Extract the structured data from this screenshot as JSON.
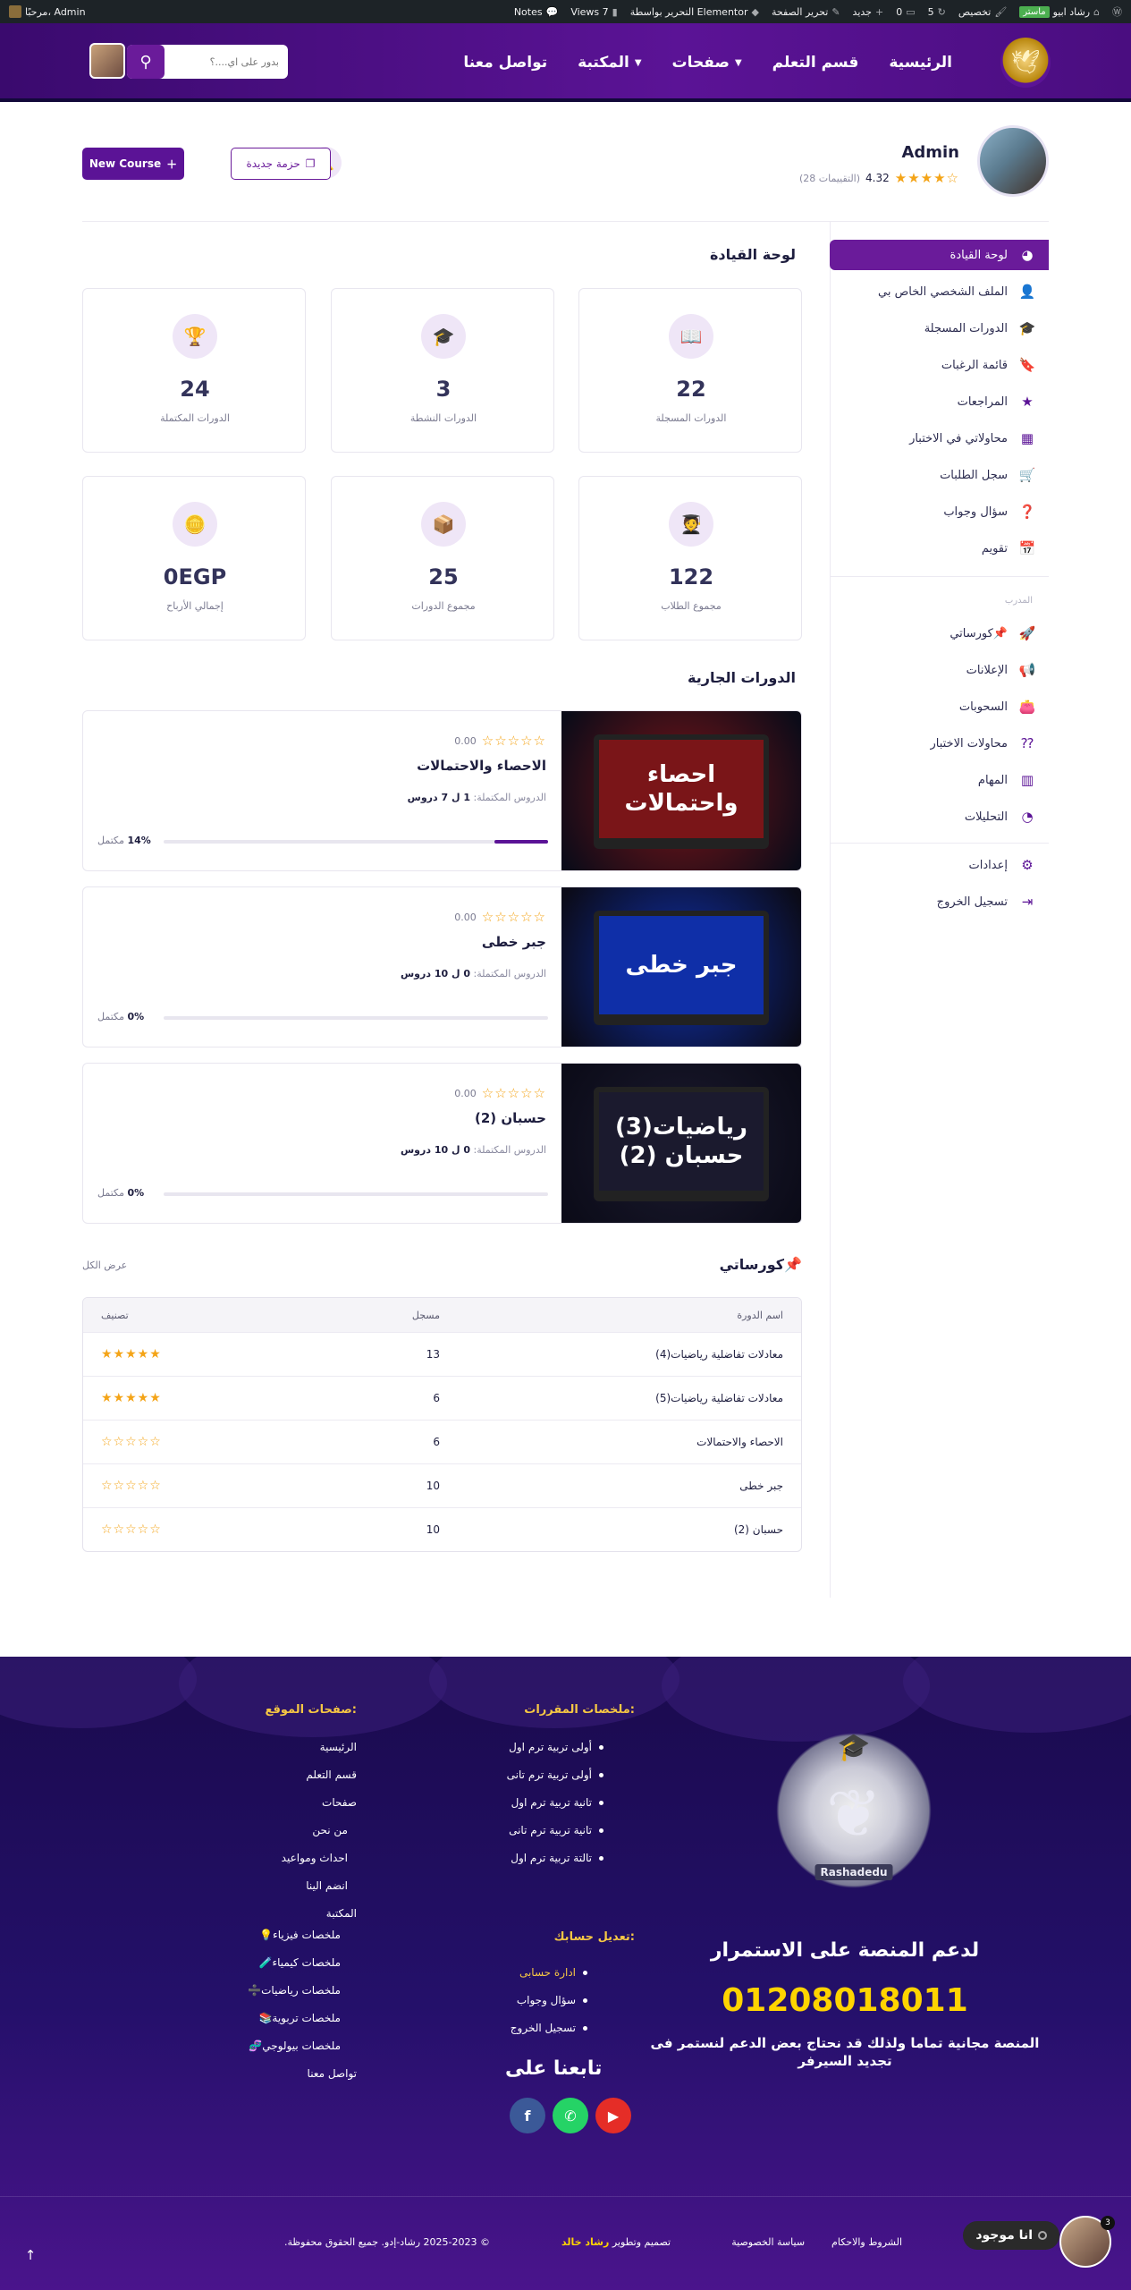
{
  "adminbar": {
    "items_right": [
      "رشاد ابيو",
      "ماستر",
      "تخصيص",
      "5",
      "0",
      "جديد",
      "تحرير الصفحة",
      "التحرير بواسطة Elementor",
      "Views 7",
      "Notes"
    ],
    "greeting": "مرحبًا، Admin"
  },
  "header": {
    "nav": [
      "الرئيسية",
      "قسم التعلم",
      "صفحات",
      "المكتبة",
      "تواصل معنا"
    ],
    "search_placeholder": "بدور على اي....؟"
  },
  "profile": {
    "name": "Admin",
    "rating": "4.32",
    "reviews": "(28 التقييمات)",
    "btn_package": "حزمة جديدة",
    "btn_new_course": "New Course"
  },
  "sidebar": {
    "main": [
      {
        "label": "لوحة القيادة",
        "icon": "palette-icon"
      },
      {
        "label": "الملف الشخصي الخاص بي",
        "icon": "user-icon"
      },
      {
        "label": "الدورات المسجلة",
        "icon": "graduation-cap-icon"
      },
      {
        "label": "قائمة الرغبات",
        "icon": "bookmark-icon"
      },
      {
        "label": "المراجعات",
        "icon": "star-icon"
      },
      {
        "label": "محاولاتي في الاختبار",
        "icon": "cubes-icon"
      },
      {
        "label": "سجل الطلبات",
        "icon": "cart-icon"
      },
      {
        "label": "سؤال وجواب",
        "icon": "question-user-icon"
      },
      {
        "label": "تقويم",
        "icon": "calendar-icon"
      }
    ],
    "instructor_label": "المدرب",
    "instructor": [
      {
        "label": "كورساتي📌",
        "icon": "rocket-icon"
      },
      {
        "label": "الإعلانات",
        "icon": "megaphone-icon"
      },
      {
        "label": "السحوبات",
        "icon": "wallet-icon"
      },
      {
        "label": "محاولات الاختبار",
        "icon": "quiz-icon"
      },
      {
        "label": "المهام",
        "icon": "building-icon"
      },
      {
        "label": "التحليلات",
        "icon": "pie-chart-icon"
      }
    ],
    "bottom": [
      {
        "label": "إعدادات",
        "icon": "gear-icon"
      },
      {
        "label": "تسجيل الخروج",
        "icon": "logout-icon"
      }
    ]
  },
  "dashboard": {
    "title": "لوحة القيادة",
    "stats": [
      {
        "value": "22",
        "label": "الدورات المسجلة",
        "icon": "book-open-icon"
      },
      {
        "value": "3",
        "label": "الدورات النشطة",
        "icon": "graduation-cap-icon"
      },
      {
        "value": "24",
        "label": "الدورات المكتملة",
        "icon": "trophy-icon"
      },
      {
        "value": "122",
        "label": "مجموع الطلاب",
        "icon": "student-icon"
      },
      {
        "value": "25",
        "label": "مجموع الدورات",
        "icon": "box-icon"
      },
      {
        "value": "0EGP",
        "label": "إجمالي الأرباح",
        "icon": "coins-icon"
      }
    ]
  },
  "current_courses": {
    "title": "الدورات الجارية",
    "lessons_prefix": "الدروس المكتملة:",
    "pct_suffix": "مكتمل",
    "items": [
      {
        "title": "الاحصاء والاحتمالات",
        "rating": "0.00",
        "lessons": "1 ل 7 دروس",
        "progress": 14,
        "pct": "14%",
        "thumb": "احصاء\nواحتمالات",
        "thumb_bg": "#7a1518"
      },
      {
        "title": "جبر خطى",
        "rating": "0.00",
        "lessons": "0 ل 10 دروس",
        "progress": 0,
        "pct": "0%",
        "thumb": "جبر خطى",
        "thumb_bg": "#0f2fa8"
      },
      {
        "title": "حسبان (2)",
        "rating": "0.00",
        "lessons": "0 ل 10 دروس",
        "progress": 0,
        "pct": "0%",
        "thumb": "رياضيات(3)\nحسبان (2)",
        "thumb_bg": "#1b1a2e"
      }
    ]
  },
  "my_courses": {
    "title": "كورساتي📌",
    "view_all": "عرض الكل",
    "headers": [
      "اسم الدورة",
      "مسجل",
      "تصنيف"
    ],
    "rows": [
      {
        "name": "معادلات تفاضلية رياضيات(4)",
        "enrolled": "13",
        "stars": 5
      },
      {
        "name": "معادلات تفاضلية رياضيات(5)",
        "enrolled": "6",
        "stars": 5
      },
      {
        "name": "الاحصاء والاحتمالات",
        "enrolled": "6",
        "stars": 0
      },
      {
        "name": "جبر خطى",
        "enrolled": "10",
        "stars": 0
      },
      {
        "name": "حسبان (2)",
        "enrolled": "10",
        "stars": 0
      }
    ]
  },
  "footer": {
    "brand": "Rashadedu",
    "support_title": "لدعم المنصة على الاستمرار",
    "phone": "01208018011",
    "support_note": "المنصة مجانية تماما ولذلك قد نحتاج بعض الدعم لنستمر فى تجديد السيرفر",
    "summaries_title": "ملخصات المقررات:",
    "summaries": [
      "أولى تربية ترم اول",
      "أولى تربية ترم تانى",
      "تانية تربية ترم اول",
      "تانية تربية ترم تانى",
      "تالتة تربية ترم اول"
    ],
    "account_title": "تعديل حسابك:",
    "account": [
      "ادارة حسابى",
      "سؤال وجواب",
      "تسجيل الخروج"
    ],
    "pages_title": "صفحات الموقع:",
    "pages": [
      "الرئيسية",
      "قسم التعلم",
      "صفحات",
      "من نحن",
      "احداث ومواعيد",
      "انضم الينا",
      "المكتبة",
      "ملخصات فيزياء💡",
      "ملخصات كيمياء🧪",
      "ملخصات رياضيات➗",
      "ملخصات تربوية📚",
      "ملخصات بيولوجي🧬",
      "تواصل معنا"
    ],
    "follow": "تابعنا على",
    "links": [
      "الشروط والاحكام",
      "سياسة الخصوصية"
    ],
    "credit_prefix": "تصميم وتطوير",
    "credit_name": "رشاد خالد",
    "copyright": "© 2025-2023 رشاد-إدو. جميع الحقوق محفوظة."
  },
  "chat": {
    "status": "انا موجود",
    "badge": "3"
  },
  "colors": {
    "primary": "#5b1396",
    "accent": "#6a1b9a",
    "star": "#f4a417",
    "phone": "#ffd400"
  }
}
